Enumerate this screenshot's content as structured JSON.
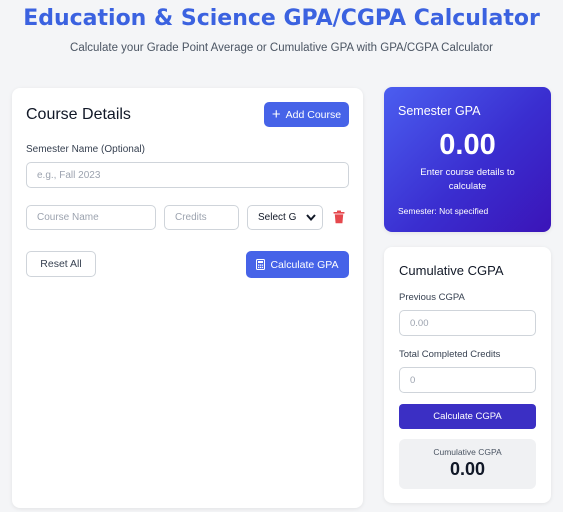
{
  "header": {
    "title": "Education & Science GPA/CGPA Calculator",
    "subtitle": "Calculate your Grade Point Average or Cumulative GPA with GPA/CGPA Calculator"
  },
  "course_details": {
    "title": "Course Details",
    "add_course_label": "Add Course",
    "semester_label": "Semester Name (Optional)",
    "semester_placeholder": "e.g., Fall 2023",
    "course_name_placeholder": "Course Name",
    "credits_placeholder": "Credits",
    "grade_select_value": "Select G",
    "reset_label": "Reset All",
    "calculate_label": "Calculate GPA"
  },
  "semester_gpa": {
    "heading": "Semester GPA",
    "value": "0.00",
    "message": "Enter course details to calculate",
    "semester": "Semester: Not specified"
  },
  "cumulative": {
    "heading": "Cumulative CGPA",
    "previous_label": "Previous CGPA",
    "previous_placeholder": "0.00",
    "credits_label": "Total Completed Credits",
    "credits_placeholder": "0",
    "calculate_label": "Calculate CGPA",
    "result_label": "Cumulative CGPA",
    "result_value": "0.00"
  },
  "colors": {
    "accent": "#4663e8",
    "title": "#3b62e0",
    "danger": "#e5484d",
    "cgpa_button": "#3b2fc4"
  },
  "icons": {
    "add": "plus-icon",
    "delete": "trash-icon",
    "calculate": "calculator-icon",
    "dropdown": "chevron-down-icon"
  }
}
